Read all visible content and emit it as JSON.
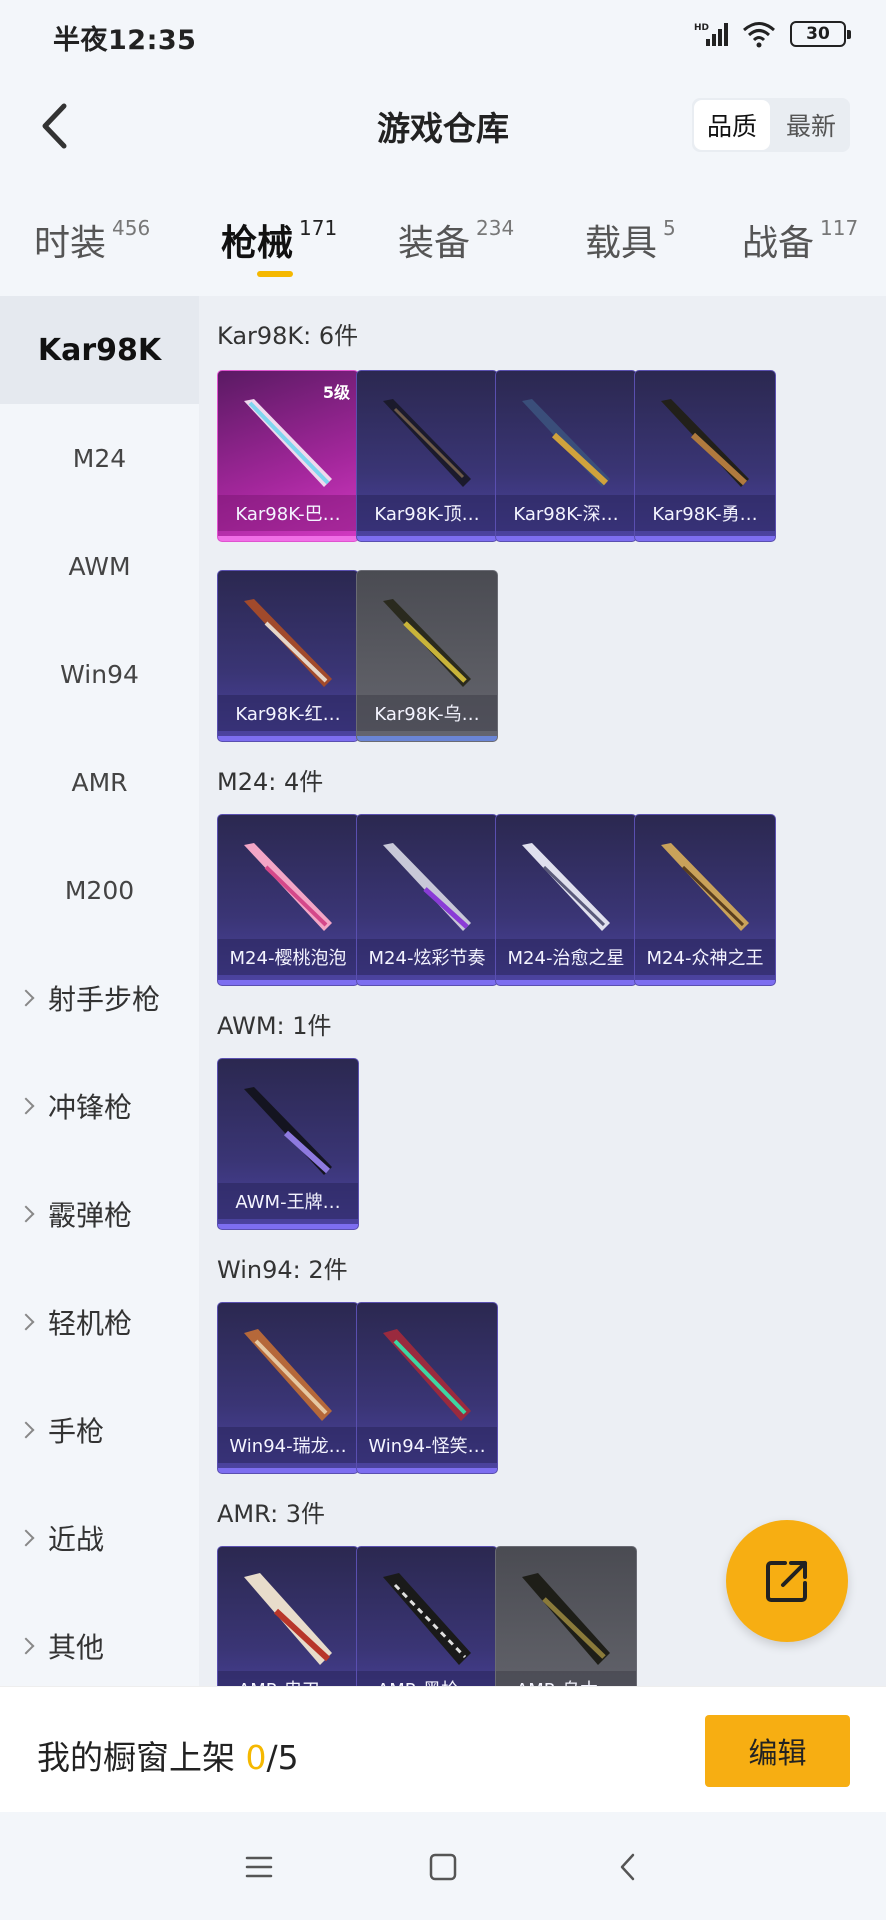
{
  "status_bar": {
    "time": "半夜12:35",
    "battery": "30"
  },
  "header": {
    "title": "游戏仓库",
    "sort_options": [
      "品质",
      "最新"
    ]
  },
  "tabs": [
    {
      "label": "时装",
      "count": "456"
    },
    {
      "label": "枪械",
      "count": "171"
    },
    {
      "label": "装备",
      "count": "234"
    },
    {
      "label": "载具",
      "count": "5"
    },
    {
      "label": "战备",
      "count": "117"
    }
  ],
  "sidebar": {
    "items": [
      "Kar98K",
      "M24",
      "AWM",
      "Win94",
      "AMR",
      "M200"
    ],
    "groups": [
      "射手步枪",
      "冲锋枪",
      "霰弹枪",
      "轻机枪",
      "手枪",
      "近战",
      "其他"
    ]
  },
  "sections": [
    {
      "title": "Kar98K: 6件",
      "items": [
        {
          "name": "Kar98K-巴…",
          "badge": "5级",
          "rarity": "pink"
        },
        {
          "name": "Kar98K-顶…",
          "rarity": "purple"
        },
        {
          "name": "Kar98K-深…",
          "rarity": "purple"
        },
        {
          "name": "Kar98K-勇…",
          "rarity": "purple"
        },
        {
          "name": "Kar98K-红…",
          "rarity": "purple"
        },
        {
          "name": "Kar98K-乌…",
          "rarity": "gray"
        }
      ]
    },
    {
      "title": "M24: 4件",
      "items": [
        {
          "name": "M24-樱桃泡泡",
          "rarity": "purple"
        },
        {
          "name": "M24-炫彩节奏",
          "rarity": "purple"
        },
        {
          "name": "M24-治愈之星",
          "rarity": "purple"
        },
        {
          "name": "M24-众神之王",
          "rarity": "purple"
        }
      ]
    },
    {
      "title": "AWM: 1件",
      "items": [
        {
          "name": "AWM-王牌…",
          "rarity": "purple"
        }
      ]
    },
    {
      "title": "Win94: 2件",
      "items": [
        {
          "name": "Win94-瑞龙…",
          "rarity": "purple"
        },
        {
          "name": "Win94-怪笑…",
          "rarity": "purple"
        }
      ]
    },
    {
      "title": "AMR: 3件",
      "items": [
        {
          "name": "AMR-忠刃…",
          "rarity": "purple"
        },
        {
          "name": "AMR-黑枪…",
          "rarity": "purple"
        },
        {
          "name": "AMR-乌木…",
          "rarity": "gray"
        }
      ]
    }
  ],
  "bottom_bar": {
    "label": "我的橱窗上架",
    "current": "0",
    "total": "/5",
    "edit_label": "编辑"
  },
  "colors": {
    "accent": "#f7ae12",
    "purple_card": "#3a3575",
    "pink_card": "#a4279c",
    "gray_card": "#5b5c63"
  }
}
